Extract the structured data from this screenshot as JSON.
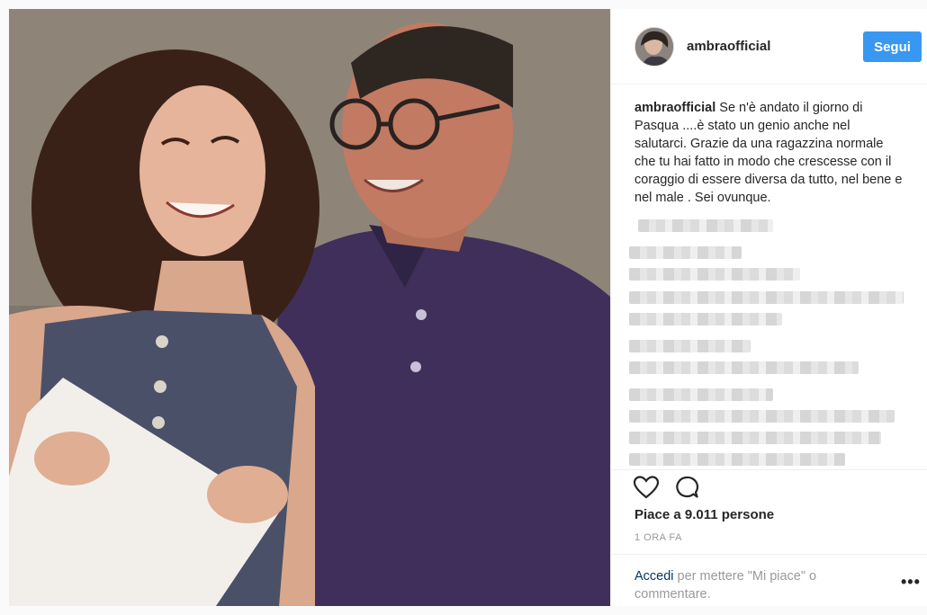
{
  "profile": {
    "username": "ambraofficial",
    "follow_label": "Segui"
  },
  "caption": {
    "username": "ambraofficial",
    "text": "Se n'è andato il giorno di Pasqua ....è stato un genio anche nel salutarci. Grazie da una ragazzina normale che tu hai fatto in modo che crescesse con il coraggio di essere diversa da tutto, nel bene e nel male . Sei ovunque."
  },
  "actions": {
    "like_icon": "heart-outline-icon",
    "comment_icon": "comment-bubble-icon",
    "likes_text": "Piace a 9.011 persone",
    "timestamp": "1 ORA FA"
  },
  "footer": {
    "login_link": "Accedi",
    "login_text": " per mettere \"Mi piace\" o commentare.",
    "more_icon": "more-dots-icon",
    "more_glyph": "•••"
  },
  "colors": {
    "follow_button": "#3897f0",
    "link": "#003569",
    "muted_text": "#999999"
  }
}
